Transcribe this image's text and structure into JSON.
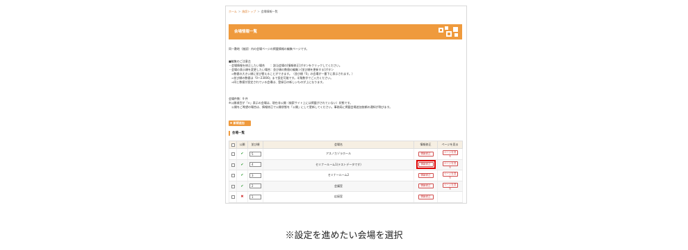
{
  "breadcrumb": {
    "home": "ホーム",
    "top": "施設トップ",
    "current": "会場情報一覧",
    "sep": ">"
  },
  "header": {
    "title": "会場情報一覧",
    "accent_color": "#ef9a3d"
  },
  "intro": "同一敷地（施設）内の会場ページの掲載情報の編集ページです。",
  "notes": {
    "title": "■編集のご注意点",
    "lines": [
      "・会場情報を修正したい場合　　：該当会場の[情報修正]ボタンをクリックしてください。",
      "・会場の表示順を変更したい場合：並び順の数値の編集＞[並び順を更新する]ボタン",
      "　⇒数値の大きい順に並び替えることができます。（並び順「0」の会場が一番下に表示されます。）",
      "　⇒並び順の数値は「0〜23000」まで設定可能です。半角数字でご入力ください。",
      "　⇒同じ数値が設定されている会場は、登録日の新しいものが上になります。"
    ]
  },
  "count": {
    "line1": "会場件数：9 件",
    "line2": "※公開項目が「×」表示の会場は、現在非公開（検索サイト上には掲載がされていない）状態です。",
    "line3": "　公開をご希望の場合は、情報修正で公開状態を「公開」にして更新してください。事務局に掲載会場追加依頼の通知が飛びます。"
  },
  "new_button": "✚ 新規追加",
  "section_title": "会場一覧",
  "table": {
    "headers": [
      "",
      "公開",
      "並び順",
      "会場名",
      "情報修正",
      "ページを見る"
    ],
    "edit_label": "情報修正",
    "view_label": "ページを見る",
    "rows": [
      {
        "public": "✔",
        "order": "5",
        "name": "アスノカゾラホール"
      },
      {
        "public": "✔",
        "order": "4",
        "name": "セミナールーム1(テストデータです)"
      },
      {
        "public": "✔",
        "order": "3",
        "name": "セミナールーム2"
      },
      {
        "public": "✔",
        "order": "2",
        "name": "会議室"
      },
      {
        "public": "✖",
        "order": "1",
        "name": "応接室"
      }
    ]
  },
  "caption": "※設定を進めたい会場を選択"
}
